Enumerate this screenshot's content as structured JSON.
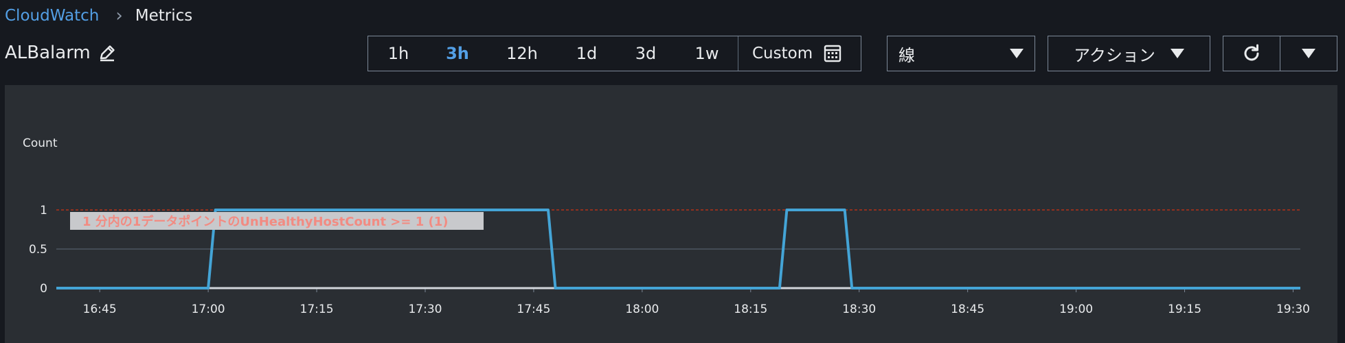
{
  "breadcrumb": {
    "root": "CloudWatch",
    "separator": "›",
    "current": "Metrics"
  },
  "graph_title": "ALBalarm",
  "time_ranges": [
    {
      "label": "1h",
      "active": false
    },
    {
      "label": "3h",
      "active": true
    },
    {
      "label": "12h",
      "active": false
    },
    {
      "label": "1d",
      "active": false
    },
    {
      "label": "3d",
      "active": false
    },
    {
      "label": "1w",
      "active": false
    }
  ],
  "custom_label": "Custom",
  "chart_type_dropdown": {
    "value": "線"
  },
  "actions_dropdown": {
    "label": "アクション"
  },
  "icons": {
    "edit": "edit-pencil-icon",
    "calendar": "calendar-icon",
    "refresh": "refresh-icon",
    "caret": "caret-down-icon"
  },
  "colors": {
    "accent": "#539fe5",
    "series": "#44a4d6",
    "threshold": "#d13212",
    "annotation_text": "#f28b82"
  },
  "chart_data": {
    "type": "line",
    "ylabel": "Count",
    "ylim": [
      0,
      1
    ],
    "yticks": [
      "0",
      "0.5",
      "1"
    ],
    "xticks": [
      "16:45",
      "17:00",
      "17:15",
      "17:30",
      "17:45",
      "18:00",
      "18:15",
      "18:30",
      "18:45",
      "19:00",
      "19:15",
      "19:30"
    ],
    "x_unit": "time",
    "series": [
      {
        "values": [
          {
            "x": "16:39",
            "y": 0
          },
          {
            "x": "17:00",
            "y": 0
          },
          {
            "x": "17:01",
            "y": 1
          },
          {
            "x": "17:47",
            "y": 1
          },
          {
            "x": "17:48",
            "y": 0
          },
          {
            "x": "18:19",
            "y": 0
          },
          {
            "x": "18:20",
            "y": 1
          },
          {
            "x": "18:28",
            "y": 1
          },
          {
            "x": "18:29",
            "y": 0
          },
          {
            "x": "19:31",
            "y": 0
          }
        ]
      }
    ],
    "threshold": {
      "value": 1,
      "label": "1 分内の1データポイントのUnHealthyHostCount >= 1 (1)"
    },
    "grid": true
  }
}
